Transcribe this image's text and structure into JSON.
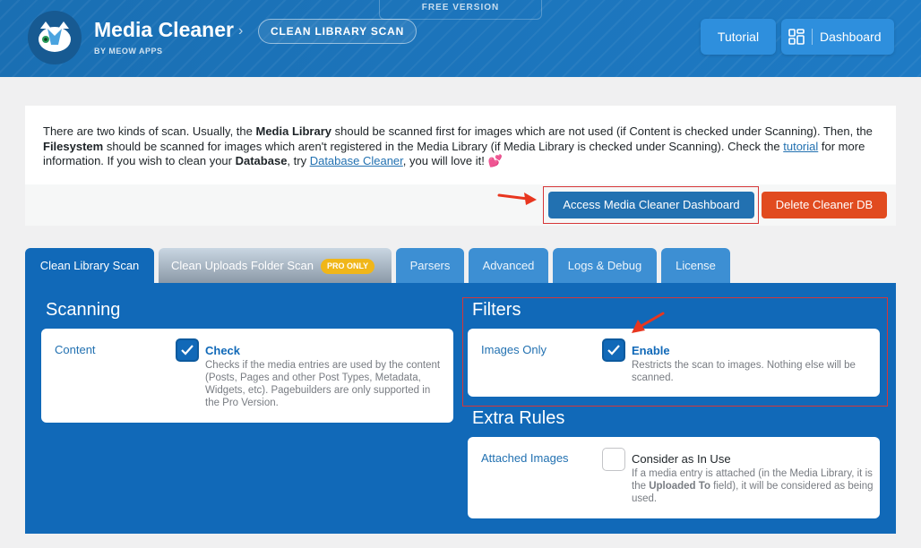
{
  "header": {
    "badge": "FREE VERSION",
    "title": "Media Cleaner",
    "subtitle": "BY MEOW APPS",
    "breadcrumb_chevron": "›",
    "breadcrumb": "CLEAN LIBRARY SCAN",
    "tutorial_button": "Tutorial",
    "dashboard_button": "Dashboard"
  },
  "info": {
    "p1": "There are two kinds of scan. Usually, the ",
    "b1": "Media Library",
    "p2": " should be scanned first for images which are not used (if Content is checked under Scanning). Then, the ",
    "b2": "Filesystem",
    "p3": " should be scanned for images which aren't registered in the Media Library (if Media Library is checked under Scanning). Check the ",
    "link1": "tutorial",
    "p4": " for more information. If you wish to clean your ",
    "b3": "Database",
    "p5": ", try ",
    "link2": "Database Cleaner",
    "p6": ", you will love it! ",
    "emoji": "💕",
    "access_button": "Access Media Cleaner Dashboard",
    "delete_button": "Delete Cleaner DB"
  },
  "tabs": [
    {
      "label": "Clean Library Scan"
    },
    {
      "label": "Clean Uploads Folder Scan",
      "badge": "PRO ONLY"
    },
    {
      "label": "Parsers"
    },
    {
      "label": "Advanced"
    },
    {
      "label": "Logs & Debug"
    },
    {
      "label": "License"
    }
  ],
  "scanning": {
    "title": "Scanning",
    "label": "Content",
    "option": "Check",
    "checked": true,
    "desc": "Checks if the media entries are used by the content (Posts, Pages and other Post Types, Metadata, Widgets, etc). Pagebuilders are only supported in the Pro Version."
  },
  "filters": {
    "title": "Filters",
    "label": "Images Only",
    "option": "Enable",
    "checked": true,
    "desc": "Restricts the scan to images. Nothing else will be scanned."
  },
  "extra_rules": {
    "title": "Extra Rules",
    "label": "Attached Images",
    "option": "Consider as In Use",
    "checked": false,
    "desc_p1": "If a media entry is attached (in the Media Library, it is the ",
    "desc_b": "Uploaded To",
    "desc_p2": " field), it will be considered as being used."
  },
  "colors": {
    "header": "#1e7ac4",
    "panel": "#1169b8",
    "accent": "#2271b1",
    "danger": "#e14b1f",
    "highlight": "#d63638",
    "pro_badge": "#f0b619"
  }
}
